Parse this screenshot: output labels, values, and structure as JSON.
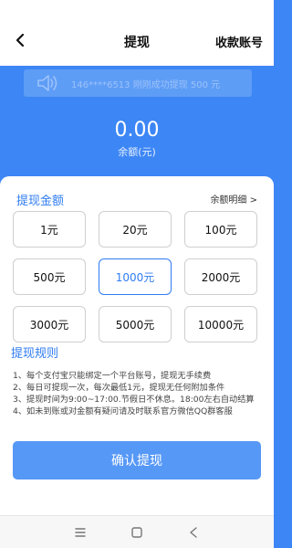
{
  "header": {
    "title": "提现",
    "account_link": "收款账号"
  },
  "notice": {
    "text": "146****6513 刚刚成功提现 500 元"
  },
  "balance": {
    "value": "0.00",
    "label": "余额(元)"
  },
  "withdraw": {
    "section_title": "提现金额",
    "detail_link": "余额明细 >",
    "amounts": [
      "1元",
      "20元",
      "100元",
      "500元",
      "1000元",
      "2000元",
      "3000元",
      "5000元",
      "10000元"
    ],
    "selected_amount": "1000元"
  },
  "rules": {
    "title": "提现规则",
    "items": [
      "1、每个支付宝只能绑定一个平台账号，提现无手续费",
      "2、每日可提现一次，每次最低1元，提现无任何附加条件",
      "3、提现时间为9:00~17:00.节假日不休息。18:00左右自动结算",
      "4、如未到账或对金额有疑问请及时联系官方微信QQ群客服"
    ]
  },
  "confirm_label": "确认提现",
  "colors": {
    "accent": "#2f7cf0",
    "hero": "#3d86f5",
    "button": "#5698f6"
  },
  "icons": [
    "back-arrow-icon",
    "speaker-icon",
    "menu-icon",
    "home-square-icon",
    "back-triangle-icon"
  ]
}
